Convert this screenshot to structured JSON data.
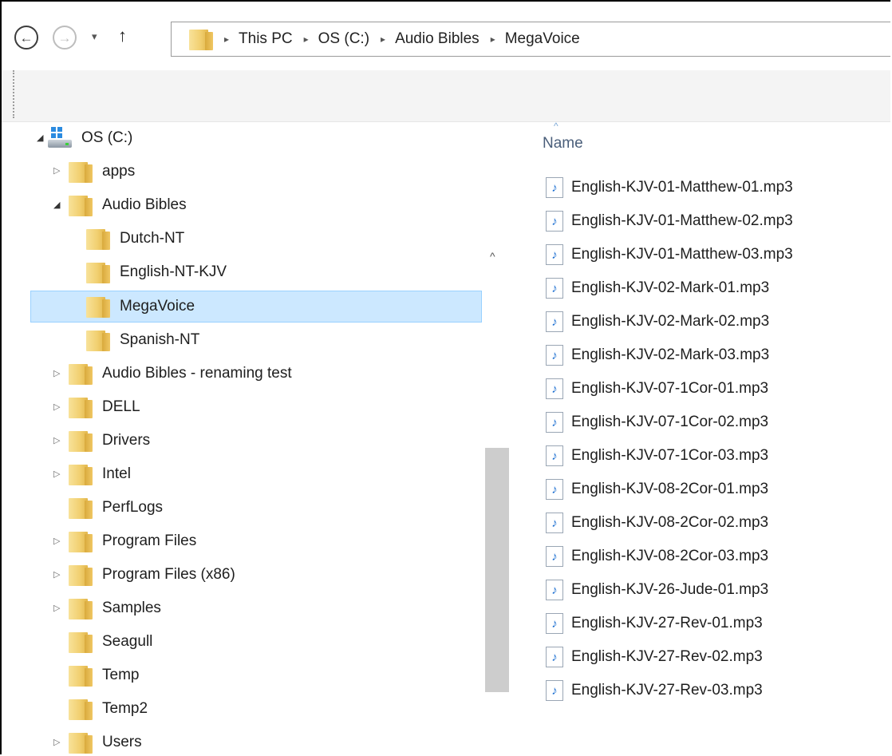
{
  "address_bar": {
    "back_glyph": "←",
    "forward_glyph": "→",
    "recent_glyph": "▾",
    "up_glyph": "↑",
    "separator_glyph": "▸",
    "breadcrumbs": [
      "This PC",
      "OS (C:)",
      "Audio Bibles",
      "MegaVoice"
    ]
  },
  "navigation": {
    "scroll_up_glyph": "^",
    "collapsed_glyph": "▷",
    "expanded_glyph": "◢",
    "drive": {
      "label": "OS (C:)"
    },
    "items": [
      {
        "label": "apps"
      },
      {
        "label": "Audio Bibles"
      },
      {
        "label": "Dutch-NT"
      },
      {
        "label": "English-NT-KJV"
      },
      {
        "label": "MegaVoice",
        "selected": true
      },
      {
        "label": "Spanish-NT"
      },
      {
        "label": "Audio Bibles - renaming test"
      },
      {
        "label": "DELL"
      },
      {
        "label": "Drivers"
      },
      {
        "label": "Intel"
      },
      {
        "label": "PerfLogs"
      },
      {
        "label": "Program Files"
      },
      {
        "label": "Program Files (x86)"
      },
      {
        "label": "Samples"
      },
      {
        "label": "Seagull"
      },
      {
        "label": "Temp"
      },
      {
        "label": "Temp2"
      },
      {
        "label": "Users"
      }
    ]
  },
  "content": {
    "sort_caret": "^",
    "column_header": "Name",
    "file_icon_glyph": "♪",
    "files": [
      "English-KJV-01-Matthew-01.mp3",
      "English-KJV-01-Matthew-02.mp3",
      "English-KJV-01-Matthew-03.mp3",
      "English-KJV-02-Mark-01.mp3",
      "English-KJV-02-Mark-02.mp3",
      "English-KJV-02-Mark-03.mp3",
      "English-KJV-07-1Cor-01.mp3",
      "English-KJV-07-1Cor-02.mp3",
      "English-KJV-07-1Cor-03.mp3",
      "English-KJV-08-2Cor-01.mp3",
      "English-KJV-08-2Cor-02.mp3",
      "English-KJV-08-2Cor-03.mp3",
      "English-KJV-26-Jude-01.mp3",
      "English-KJV-27-Rev-01.mp3",
      "English-KJV-27-Rev-02.mp3",
      "English-KJV-27-Rev-03.mp3"
    ]
  },
  "colors": {
    "selection_fill": "#cce8ff",
    "selection_border": "#99d1ff",
    "header_text": "#4a5e7a",
    "scrollbar_thumb": "#cdcdcd"
  }
}
